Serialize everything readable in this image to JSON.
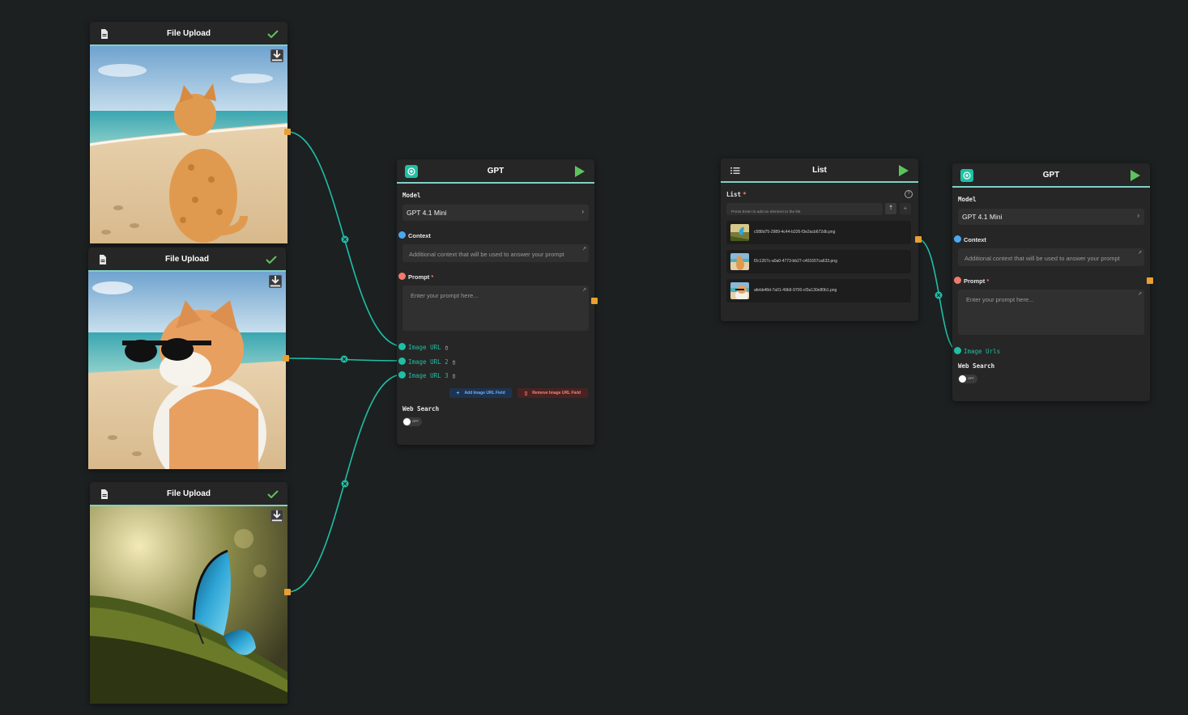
{
  "upload_nodes": [
    {
      "title": "File Upload",
      "image": "cat sitting on beach, seen from behind"
    },
    {
      "title": "File Upload",
      "image": "cat wearing sunglasses on beach"
    },
    {
      "title": "File Upload",
      "image": "blue butterfly on mossy ground"
    }
  ],
  "gpt_node_1": {
    "title": "GPT",
    "model_label": "Model",
    "model_value": "GPT 4.1 Mini",
    "context_label": "Context",
    "context_placeholder": "Additional context that will be used to answer your prompt",
    "prompt_label": "Prompt",
    "prompt_required": "*",
    "prompt_placeholder": "Enter your prompt here...",
    "image_urls": [
      "Image URL",
      "Image URL 2",
      "Image URL 3"
    ],
    "add_button": "Add Image URL Field",
    "remove_button": "Remove Image URL Field",
    "web_search_label": "Web Search",
    "web_search_state": "OFF"
  },
  "list_node": {
    "title": "List",
    "list_label": "List",
    "list_required": "*",
    "input_placeholder": "Press Enter to add an element to the list",
    "items": [
      "c588d75-2989-4c44-b326-f3e2acb672db.png",
      "f2c1267c-a0a0-4773-bb27-c401657ca633.png",
      "afebb48d-7a01-49b9-9700-cf3a130e80b1.png"
    ]
  },
  "gpt_node_2": {
    "title": "GPT",
    "model_label": "Model",
    "model_value": "GPT 4.1 Mini",
    "context_label": "Context",
    "context_placeholder": "Additional context that will be used to answer your prompt",
    "prompt_label": "Prompt",
    "prompt_required": "*",
    "prompt_placeholder": "Enter your prompt here...",
    "image_urls_label": "Image Urls",
    "web_search_label": "Web Search",
    "web_search_state": "OFF"
  },
  "colors": {
    "background": "#1c2021",
    "node": "#262626",
    "accent": "#7fd1c7",
    "edge": "#1fbfa5",
    "handle": "#e8a030",
    "context_dot": "#4aa8f0",
    "prompt_dot": "#f07a6a",
    "image_dot": "#1fbfa5",
    "check": "#5cc45c"
  }
}
